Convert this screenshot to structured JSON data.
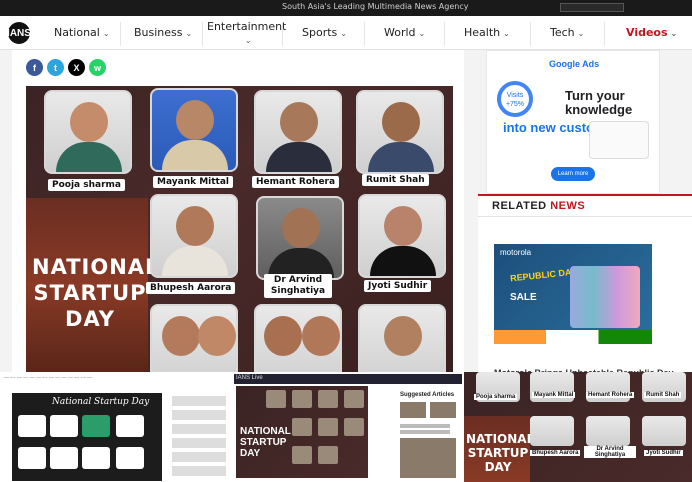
{
  "topbar": {
    "tagline": "South Asia's Leading Multimedia News Agency"
  },
  "nav": {
    "logo": "IANS",
    "items": [
      "National",
      "Business",
      "Entertainment",
      "Sports",
      "World",
      "Health",
      "Tech",
      "Videos"
    ]
  },
  "share": [
    "f",
    "t",
    "X",
    "w"
  ],
  "hero": {
    "title_lines": [
      "NATIONAL",
      "STARTUP",
      "DAY"
    ],
    "people": [
      "Pooja sharma",
      "Mayank Mittal",
      "Hemant Rohera",
      "Rumit Shah",
      "Bhupesh Aarora",
      "Dr Arvind Singhatiya",
      "Jyoti Sudhir"
    ]
  },
  "ad": {
    "brand": "Google Ads",
    "visits": "Visits +75%",
    "headline1": "Turn your knowledge",
    "headline2": "into new customers",
    "cta": "Learn more"
  },
  "related": {
    "title_a": "RELATED",
    "title_b": "NEWS",
    "promo_brand": "motorola",
    "promo_event": "REPUBLIC DAY",
    "promo_sale": "SALE",
    "headline": "Motorola Brings Unbeatable Republic Day"
  },
  "strip": {
    "thumb1_title": "National Startup Day",
    "thumb2_side_title": "Suggested Articles",
    "thumb2_header": "IANS Live",
    "thumb2_big": [
      "NATIONAL",
      "STARTUP",
      "DAY"
    ],
    "thumb3_big": [
      "NATIONAL",
      "STARTUP",
      "DAY"
    ],
    "thumb3_names": [
      "Pooja sharma",
      "Mayank Mittal",
      "Hemant Rohera",
      "Rumit Shah",
      "Bhupesh Aarora",
      "Dr Arvind Singhatiya",
      "Jyoti Sudhir"
    ]
  }
}
